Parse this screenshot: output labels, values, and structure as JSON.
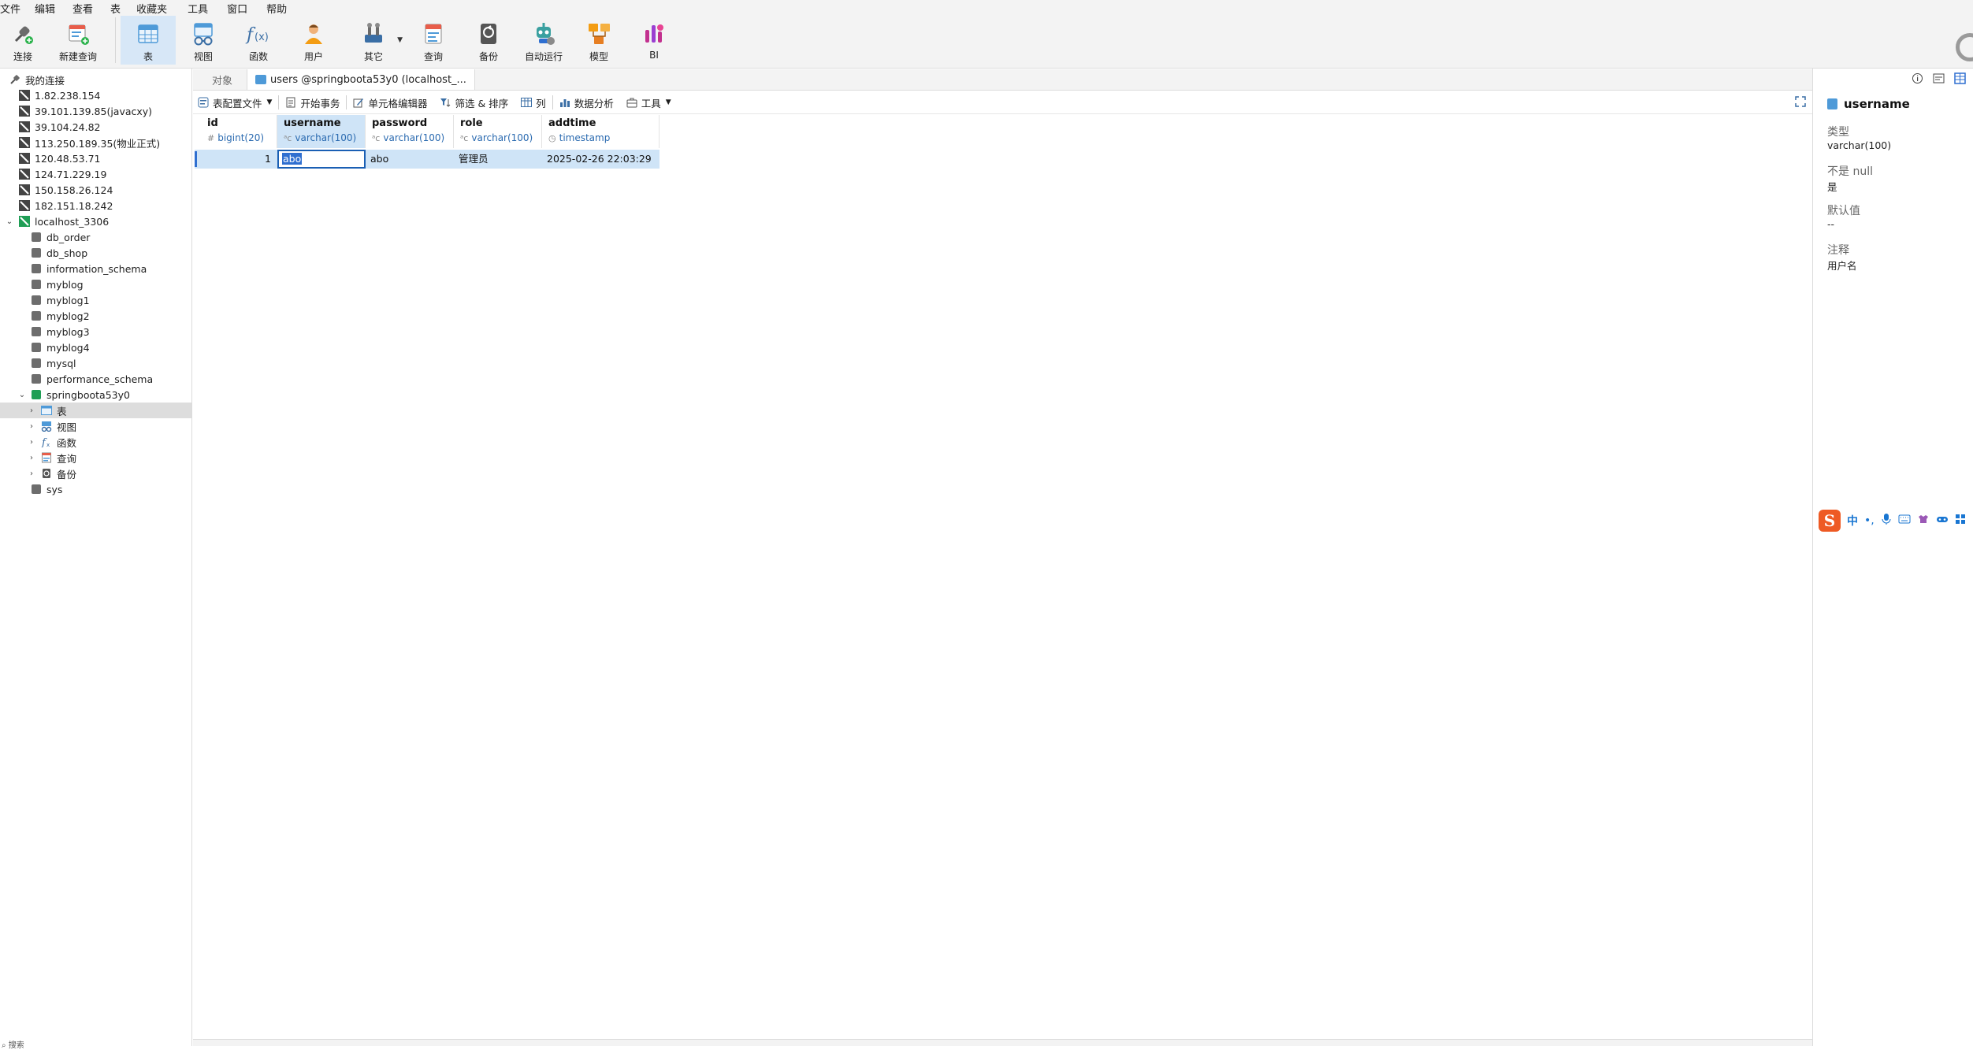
{
  "menu": [
    "文件",
    "编辑",
    "查看",
    "表",
    "收藏夹",
    "工具",
    "窗口",
    "帮助"
  ],
  "toolbar": {
    "connect": "连接",
    "new_query": "新建查询",
    "table": "表",
    "view": "视图",
    "function": "函数",
    "user": "用户",
    "other": "其它",
    "query": "查询",
    "backup": "备份",
    "automation": "自动运行",
    "model": "模型",
    "bi": "BI"
  },
  "sidebar": {
    "root": "我的连接",
    "servers": [
      "1.82.238.154",
      "39.101.139.85(javacxy)",
      "39.104.24.82",
      "113.250.189.35(物业正式)",
      "120.48.53.71",
      "124.71.229.19",
      "150.158.26.124",
      "182.151.18.242"
    ],
    "local": "localhost_3306",
    "databases": [
      "db_order",
      "db_shop",
      "information_schema",
      "myblog",
      "myblog1",
      "myblog2",
      "myblog3",
      "myblog4",
      "mysql",
      "performance_schema"
    ],
    "open_db": "springboota53y0",
    "children": [
      "表",
      "视图",
      "函数",
      "查询",
      "备份"
    ],
    "last_db": "sys",
    "bottom_search": "搜索"
  },
  "tabs": {
    "objects": "对象",
    "current": "users @springboota53y0 (localhost_..."
  },
  "gridbar": {
    "profile": "表配置文件",
    "begin_tx": "开始事务",
    "cell_editor": "单元格编辑器",
    "filter_sort": "筛选 & 排序",
    "columns": "列",
    "analysis": "数据分析",
    "tools": "工具"
  },
  "grid": {
    "columns": [
      {
        "name": "id",
        "type": "bigint(20)",
        "glyph": "#"
      },
      {
        "name": "username",
        "type": "varchar(100)",
        "glyph": "ᵃᴄ"
      },
      {
        "name": "password",
        "type": "varchar(100)",
        "glyph": "ᵃᴄ"
      },
      {
        "name": "role",
        "type": "varchar(100)",
        "glyph": "ᵃᴄ"
      },
      {
        "name": "addtime",
        "type": "timestamp",
        "glyph": "◷"
      }
    ],
    "rows": [
      {
        "id": "1",
        "username": "abo",
        "password": "abo",
        "role": "管理员",
        "addtime": "2025-02-26 22:03:29"
      }
    ]
  },
  "info": {
    "title": "username",
    "type_label": "类型",
    "type_value": "varchar(100)",
    "notnull_label": "不是 null",
    "notnull_value": "是",
    "default_label": "默认值",
    "default_value": "--",
    "comment_label": "注释",
    "comment_value": "用户名"
  },
  "ime": {
    "logo": "S",
    "mode": "中",
    "punct": "•,"
  },
  "colors": {
    "selection": "#cfe4f7",
    "accent": "#2f6fd0",
    "open_db": "#1f9e55"
  }
}
